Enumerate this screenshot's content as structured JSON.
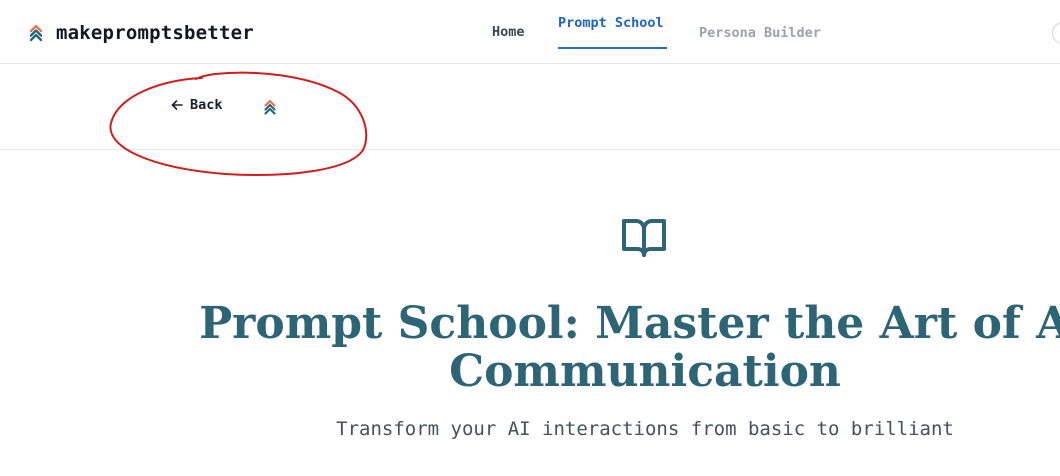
{
  "brand": {
    "name": "makepromptsbetter",
    "logo_colors": [
      "#e8735a",
      "#2d6577"
    ]
  },
  "nav": {
    "home": "Home",
    "prompt_school": "Prompt School",
    "persona_builder": "Persona Builder",
    "active": "Prompt School",
    "active_color": "#1e63c8"
  },
  "subbar": {
    "back_label": "Back",
    "back_icon": "arrow-left-icon",
    "logo_icon": "chevrons-up-icon"
  },
  "annotation": {
    "shape": "hand-drawn ellipse",
    "color": "#d21c1c"
  },
  "hero": {
    "icon": "book-open-icon",
    "title": "Prompt School: Master the Art of AI Communication",
    "subtitle": "Transform your AI interactions from basic to brilliant",
    "title_color": "#2d6577"
  }
}
